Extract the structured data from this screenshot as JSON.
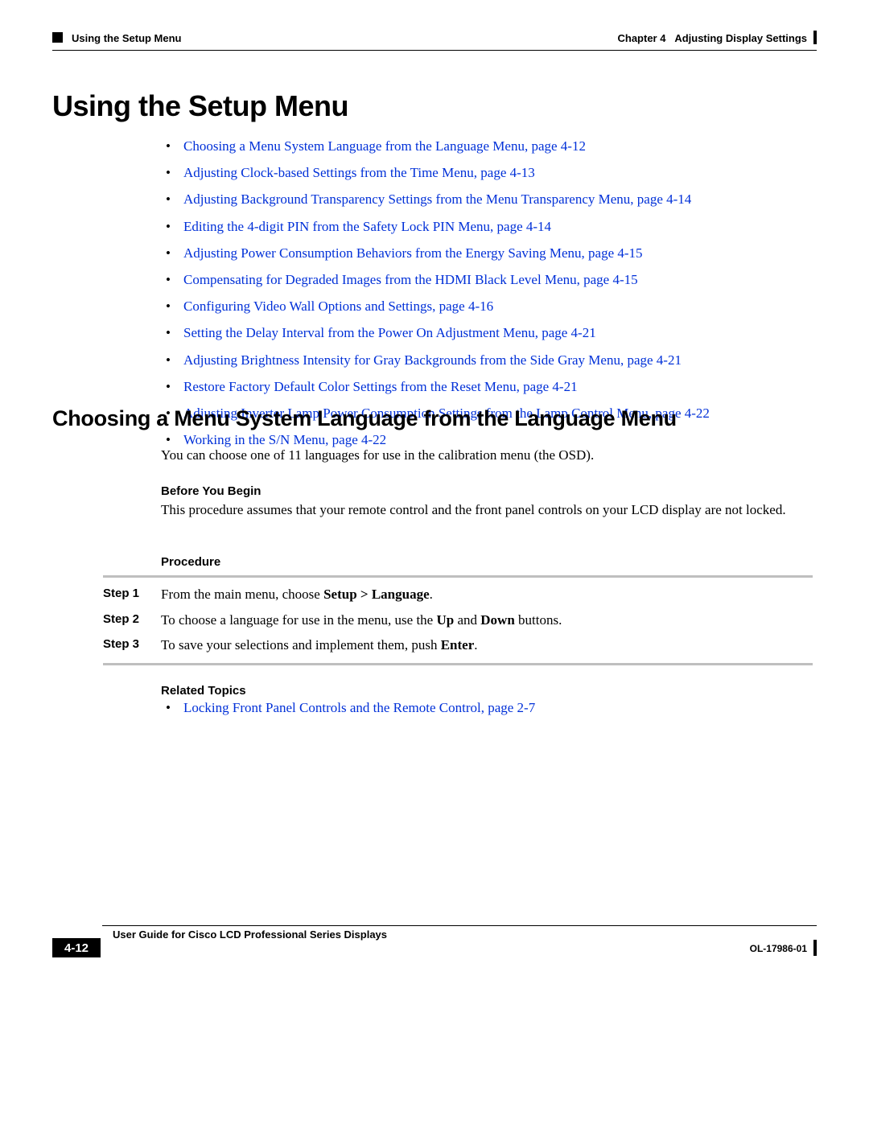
{
  "header": {
    "section": "Using the Setup Menu",
    "chapter_label": "Chapter 4",
    "chapter_title": "Adjusting Display Settings"
  },
  "h1": "Using the Setup Menu",
  "links": [
    "Choosing a Menu System Language from the Language Menu, page 4-12",
    "Adjusting Clock-based Settings from the Time Menu, page 4-13",
    "Adjusting Background Transparency Settings from the Menu Transparency Menu, page 4-14",
    "Editing the 4-digit PIN from the Safety Lock PIN Menu, page 4-14",
    "Adjusting Power Consumption Behaviors from the Energy Saving Menu, page 4-15",
    "Compensating for Degraded Images from the HDMI Black Level Menu, page 4-15",
    "Configuring Video Wall Options and Settings, page 4-16",
    "Setting the Delay Interval from the Power On Adjustment Menu, page 4-21",
    "Adjusting Brightness Intensity for Gray Backgrounds from the Side Gray Menu, page 4-21",
    "Restore Factory Default Color Settings from the Reset Menu, page 4-21",
    "Adjusting Inverter Lamp Power Consumption Settings from the Lamp Control Menu, page 4-22",
    "Working in the S/N Menu, page 4-22"
  ],
  "h2": "Choosing a Menu System Language from the Language Menu",
  "desc": "You can choose one of 11 languages for use in the calibration menu (the OSD).",
  "before_heading": "Before You Begin",
  "before_text": "This procedure assumes that your remote control and the front panel controls on your LCD display are not locked.",
  "procedure_heading": "Procedure",
  "steps": [
    {
      "label": "Step 1",
      "pre": "From the main menu, choose ",
      "b1": "Setup > Language",
      "post": "."
    },
    {
      "label": "Step 2",
      "pre": "To choose a language for use in the menu, use the ",
      "b1": "Up",
      "mid": " and ",
      "b2": "Down",
      "post": " buttons."
    },
    {
      "label": "Step 3",
      "pre": "To save your selections and implement them, push ",
      "b1": "Enter",
      "post": "."
    }
  ],
  "related_heading": "Related Topics",
  "related": [
    "Locking Front Panel Controls and the Remote Control, page 2-7"
  ],
  "footer": {
    "guide": "User Guide for Cisco LCD Professional Series Displays",
    "page": "4-12",
    "docid": "OL-17986-01"
  }
}
